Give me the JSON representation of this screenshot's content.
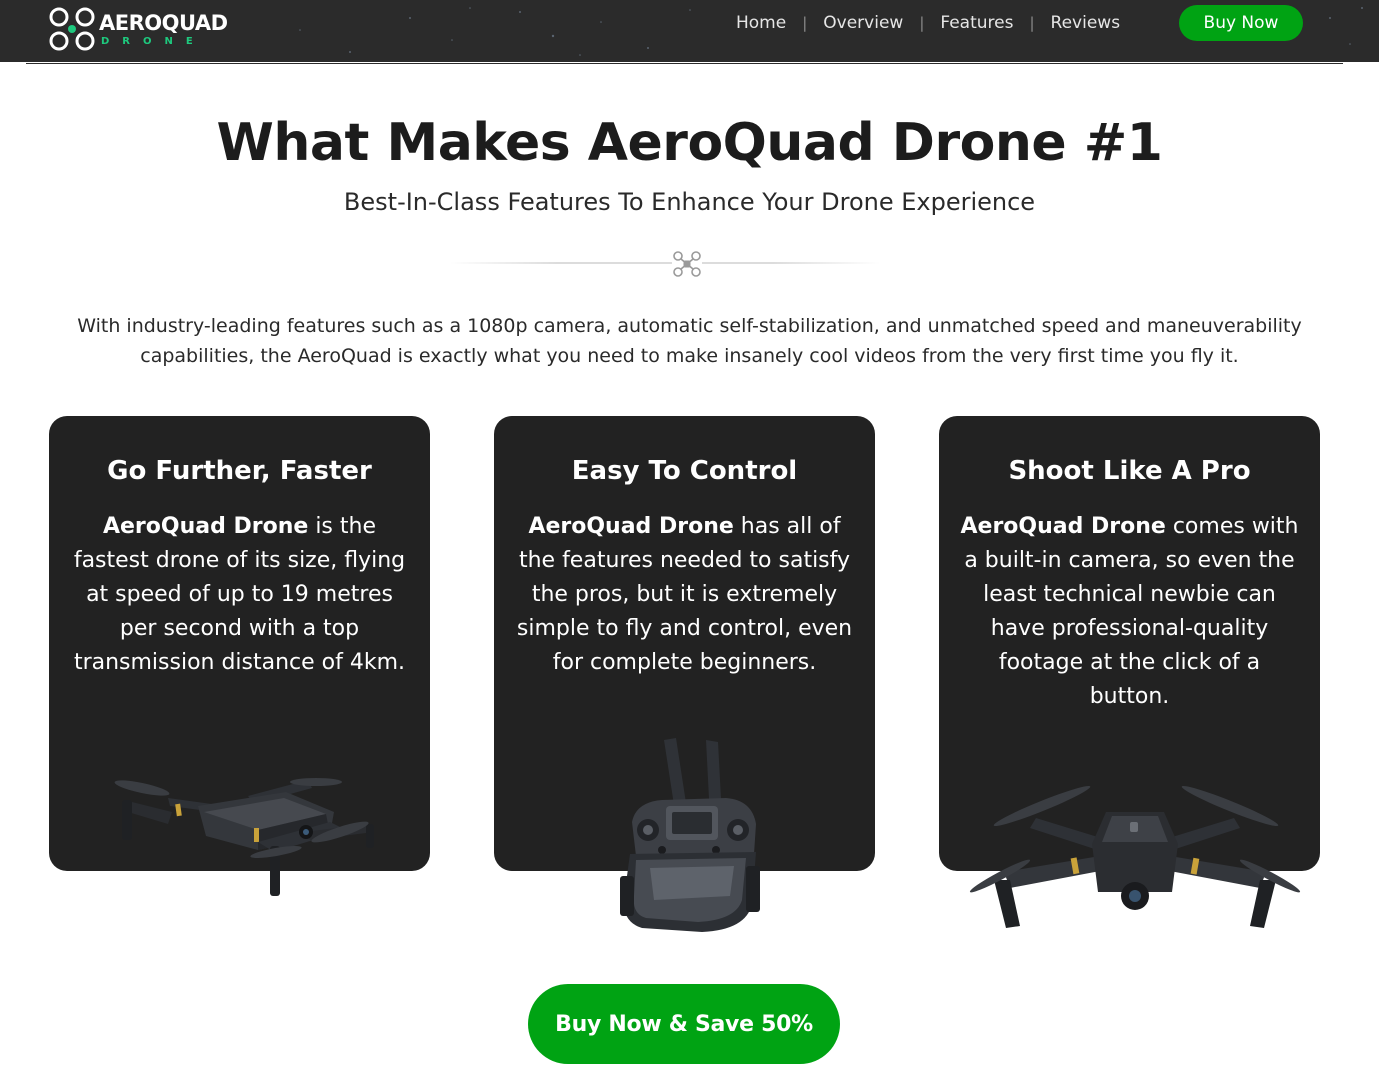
{
  "header": {
    "logo": {
      "word": "AEROQUAD",
      "sub": "DRONE"
    },
    "nav": [
      {
        "label": "Home"
      },
      {
        "label": "Overview"
      },
      {
        "label": "Features"
      },
      {
        "label": "Reviews"
      }
    ],
    "nav_separator": "|",
    "buy_label": "Buy Now",
    "colors": {
      "bar": "#2b2b2b",
      "accent": "#00a313",
      "logo_sub": "#1ec97e"
    }
  },
  "hero": {
    "title": "What Makes AeroQuad Drone #1",
    "subtitle": "Best-In-Class Features To Enhance Your Drone Experience",
    "divider_icon": "drone-icon",
    "intro": "With industry-leading features such as a 1080p camera, automatic self-stabilization, and unmatched speed and maneuverability capabilities, the AeroQuad is exactly what you need to make insanely cool videos from the very first time you fly it."
  },
  "cards": [
    {
      "title": "Go Further, Faster",
      "brand": "AeroQuad Drone",
      "text": " is the fastest drone of its size, flying at speed of up to 19 metres per second with a top transmission distance of 4km.",
      "image": "folded-drone-side-view"
    },
    {
      "title": "Easy To Control",
      "brand": "AeroQuad Drone",
      "text": " has all of the features needed to satisfy the pros, but it is extremely simple to fly and control, even for complete beginners.",
      "image": "remote-controller"
    },
    {
      "title": "Shoot Like A Pro",
      "brand": "AeroQuad Drone",
      "text": " comes with a built-in camera, so even the least technical newbie can have professional-quality footage at the click of a button.",
      "image": "drone-front-view"
    }
  ],
  "cta": {
    "label": "Buy Now & Save 50%"
  },
  "colors": {
    "card_bg": "#222222",
    "cta": "#00a313"
  }
}
